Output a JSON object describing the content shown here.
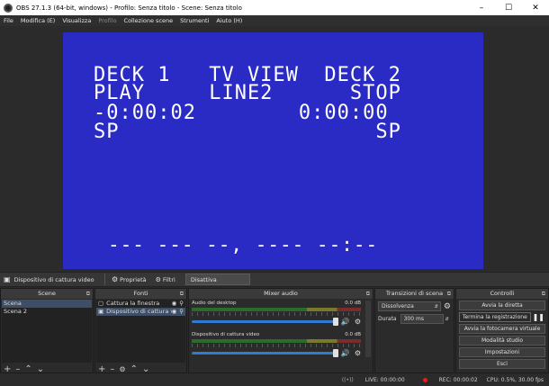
{
  "window": {
    "title": "OBS 27.1.3 (64-bit, windows) - Profilo: Senza titolo - Scene: Senza titolo"
  },
  "menu": [
    {
      "label": "File",
      "enabled": true
    },
    {
      "label": "Modifica (E)",
      "enabled": true
    },
    {
      "label": "Visualizza",
      "enabled": true
    },
    {
      "label": "Profilo",
      "enabled": false
    },
    {
      "label": "Collezione scene",
      "enabled": true
    },
    {
      "label": "Strumenti",
      "enabled": true
    },
    {
      "label": "Aiuto (H)",
      "enabled": true
    }
  ],
  "preview": {
    "lines": [
      "DECK 1   TV VIEW  DECK 2",
      "PLAY     LINE2      STOP",
      "-0:00:02        0:00:00",
      "SP                    SP",
      "--- --- --, ---- --:--"
    ],
    "bg_color": "#2a2ac4"
  },
  "source_bar": {
    "source_label": "Dispositivo di cattura video",
    "properties": "Proprietà",
    "filters": "Filtri",
    "deactivate": "Disattiva"
  },
  "scenes": {
    "title": "Scene",
    "items": [
      "Scena",
      "Scena 2"
    ]
  },
  "sources": {
    "title": "Fonti",
    "items": [
      "Cattura la finestra",
      "Dispositivo di cattura v"
    ]
  },
  "mixer": {
    "title": "Mixer audio",
    "channels": [
      {
        "name": "Audio del desktop",
        "db": "0.0 dB"
      },
      {
        "name": "Dispositivo di cattura video",
        "db": "0.0 dB"
      }
    ]
  },
  "transitions": {
    "title": "Transizioni di scena",
    "selected": "Dissolvenza",
    "duration_label": "Durata",
    "duration": "300 ms"
  },
  "controls": {
    "title": "Controlli",
    "buttons": [
      "Avvia la diretta",
      "Termina la registrazione",
      "Avvia la fotocamera virtuale",
      "Modalità studio",
      "Impostazioni",
      "Esci"
    ]
  },
  "status": {
    "live": "LIVE: 00:00:00",
    "rec": "REC: 00:00:02",
    "cpu": "CPU: 0.5%, 30.00 fps"
  }
}
